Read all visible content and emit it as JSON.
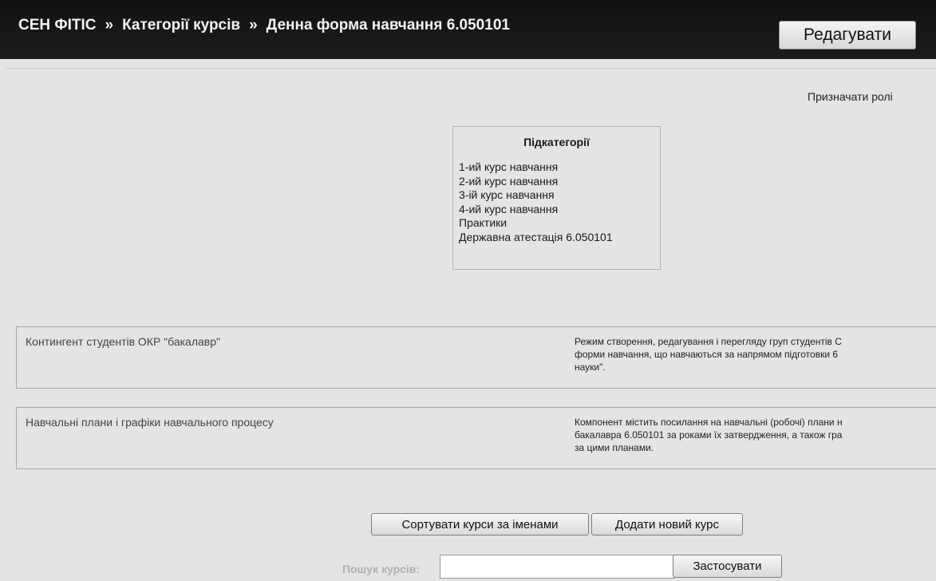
{
  "header": {
    "breadcrumb": [
      "СЕН ФІТІС",
      "Категорії курсів",
      "Денна форма навчання 6.050101"
    ],
    "separator": "»",
    "edit_button": "Редагувати"
  },
  "assign_roles": "Призначати ролі",
  "subcategories": {
    "title": "Підкатегорії",
    "items": [
      "1-ий курс навчання",
      "2-ий курс навчання",
      "3-ій курс навчання",
      "4-ий курс навчання",
      "Практики",
      "Державна атестація 6.050101"
    ]
  },
  "courses": [
    {
      "name": "Контингент студентів ОКР \"бакалавр\"",
      "summary_lines": [
        "Режим створення, редагування і перегляду груп студентів С",
        "форми навчання, що навчаються за напрямом підготовки 6",
        "науки\"."
      ]
    },
    {
      "name": "Навчальні плани і графіки навчального процесу",
      "summary_lines": [
        "Компонент містить посилання на навчальні (робочі) плани н",
        "бакалавра 6.050101 за роками їх затвердження, а також гра",
        "за цими планами."
      ]
    }
  ],
  "actions": {
    "sort_button": "Сортувати курси за іменами",
    "add_button": "Додати новий курс"
  },
  "search": {
    "label": "Пошук курсів:",
    "value": "",
    "apply_button": "Застосувати"
  }
}
